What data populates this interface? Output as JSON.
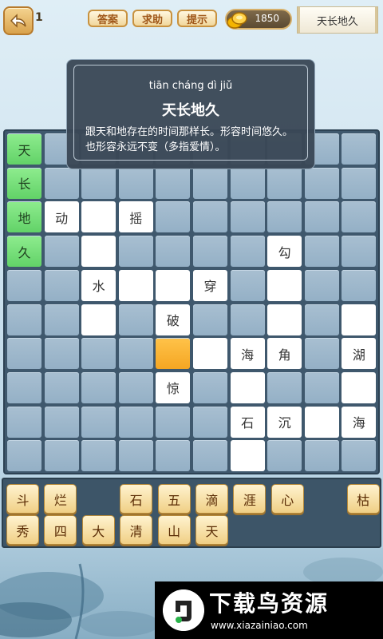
{
  "topbar": {
    "level": "1",
    "answer_label": "答案",
    "help_label": "求助",
    "hint_label": "提示",
    "coins": "1850",
    "current_idiom": "天长地久"
  },
  "popup": {
    "pinyin": "tiān cháng dì jiǔ",
    "idiom": "天长地久",
    "meaning": "跟天和地存在的时间那样长。形容时间悠久。也形容永远不变（多指爱情）。"
  },
  "board": {
    "rows": 10,
    "cols": 10,
    "cells": [
      {
        "r": 0,
        "c": 0,
        "t": "green",
        "ch": "天"
      },
      {
        "r": 1,
        "c": 0,
        "t": "green",
        "ch": "长"
      },
      {
        "r": 2,
        "c": 0,
        "t": "green",
        "ch": "地"
      },
      {
        "r": 2,
        "c": 1,
        "t": "white",
        "ch": "动"
      },
      {
        "r": 2,
        "c": 2,
        "t": "white",
        "ch": ""
      },
      {
        "r": 2,
        "c": 3,
        "t": "white",
        "ch": "摇"
      },
      {
        "r": 3,
        "c": 0,
        "t": "green",
        "ch": "久"
      },
      {
        "r": 3,
        "c": 2,
        "t": "white",
        "ch": ""
      },
      {
        "r": 3,
        "c": 7,
        "t": "white",
        "ch": "勾"
      },
      {
        "r": 4,
        "c": 2,
        "t": "white",
        "ch": "水"
      },
      {
        "r": 4,
        "c": 3,
        "t": "white",
        "ch": ""
      },
      {
        "r": 4,
        "c": 4,
        "t": "white",
        "ch": ""
      },
      {
        "r": 4,
        "c": 5,
        "t": "white",
        "ch": "穿"
      },
      {
        "r": 4,
        "c": 7,
        "t": "white",
        "ch": ""
      },
      {
        "r": 5,
        "c": 2,
        "t": "white",
        "ch": ""
      },
      {
        "r": 5,
        "c": 4,
        "t": "white",
        "ch": "破"
      },
      {
        "r": 5,
        "c": 7,
        "t": "white",
        "ch": ""
      },
      {
        "r": 5,
        "c": 9,
        "t": "white",
        "ch": ""
      },
      {
        "r": 6,
        "c": 4,
        "t": "orange",
        "ch": ""
      },
      {
        "r": 6,
        "c": 5,
        "t": "white",
        "ch": ""
      },
      {
        "r": 6,
        "c": 6,
        "t": "white",
        "ch": "海"
      },
      {
        "r": 6,
        "c": 7,
        "t": "white",
        "ch": "角"
      },
      {
        "r": 6,
        "c": 9,
        "t": "white",
        "ch": "湖"
      },
      {
        "r": 7,
        "c": 4,
        "t": "white",
        "ch": "惊"
      },
      {
        "r": 7,
        "c": 6,
        "t": "white",
        "ch": ""
      },
      {
        "r": 7,
        "c": 9,
        "t": "white",
        "ch": ""
      },
      {
        "r": 8,
        "c": 6,
        "t": "white",
        "ch": "石"
      },
      {
        "r": 8,
        "c": 7,
        "t": "white",
        "ch": "沉"
      },
      {
        "r": 8,
        "c": 8,
        "t": "white",
        "ch": ""
      },
      {
        "r": 8,
        "c": 9,
        "t": "white",
        "ch": "海"
      },
      {
        "r": 9,
        "c": 6,
        "t": "white",
        "ch": ""
      }
    ]
  },
  "tray": {
    "tiles": [
      {
        "row": 0,
        "col": 0,
        "ch": "斗"
      },
      {
        "row": 0,
        "col": 1,
        "ch": "烂"
      },
      {
        "row": 0,
        "col": 3,
        "ch": "石"
      },
      {
        "row": 0,
        "col": 4,
        "ch": "五"
      },
      {
        "row": 0,
        "col": 5,
        "ch": "滴"
      },
      {
        "row": 0,
        "col": 6,
        "ch": "涯"
      },
      {
        "row": 0,
        "col": 7,
        "ch": "心"
      },
      {
        "row": 0,
        "col": 9,
        "ch": "枯"
      },
      {
        "row": 1,
        "col": 0,
        "ch": "秀"
      },
      {
        "row": 1,
        "col": 1,
        "ch": "四"
      },
      {
        "row": 1,
        "col": 2,
        "ch": "大"
      },
      {
        "row": 1,
        "col": 3,
        "ch": "清"
      },
      {
        "row": 1,
        "col": 4,
        "ch": "山"
      },
      {
        "row": 1,
        "col": 5,
        "ch": "天"
      }
    ]
  },
  "banner": {
    "title": "下载鸟资源",
    "url": "www.xiazainiao.com"
  },
  "colors": {
    "board_bg": "#3f586d",
    "cell_empty": "#9fb8cc",
    "cell_green": "#6fdc74",
    "cell_orange": "#f5a623",
    "tile": "#f0cf85"
  }
}
